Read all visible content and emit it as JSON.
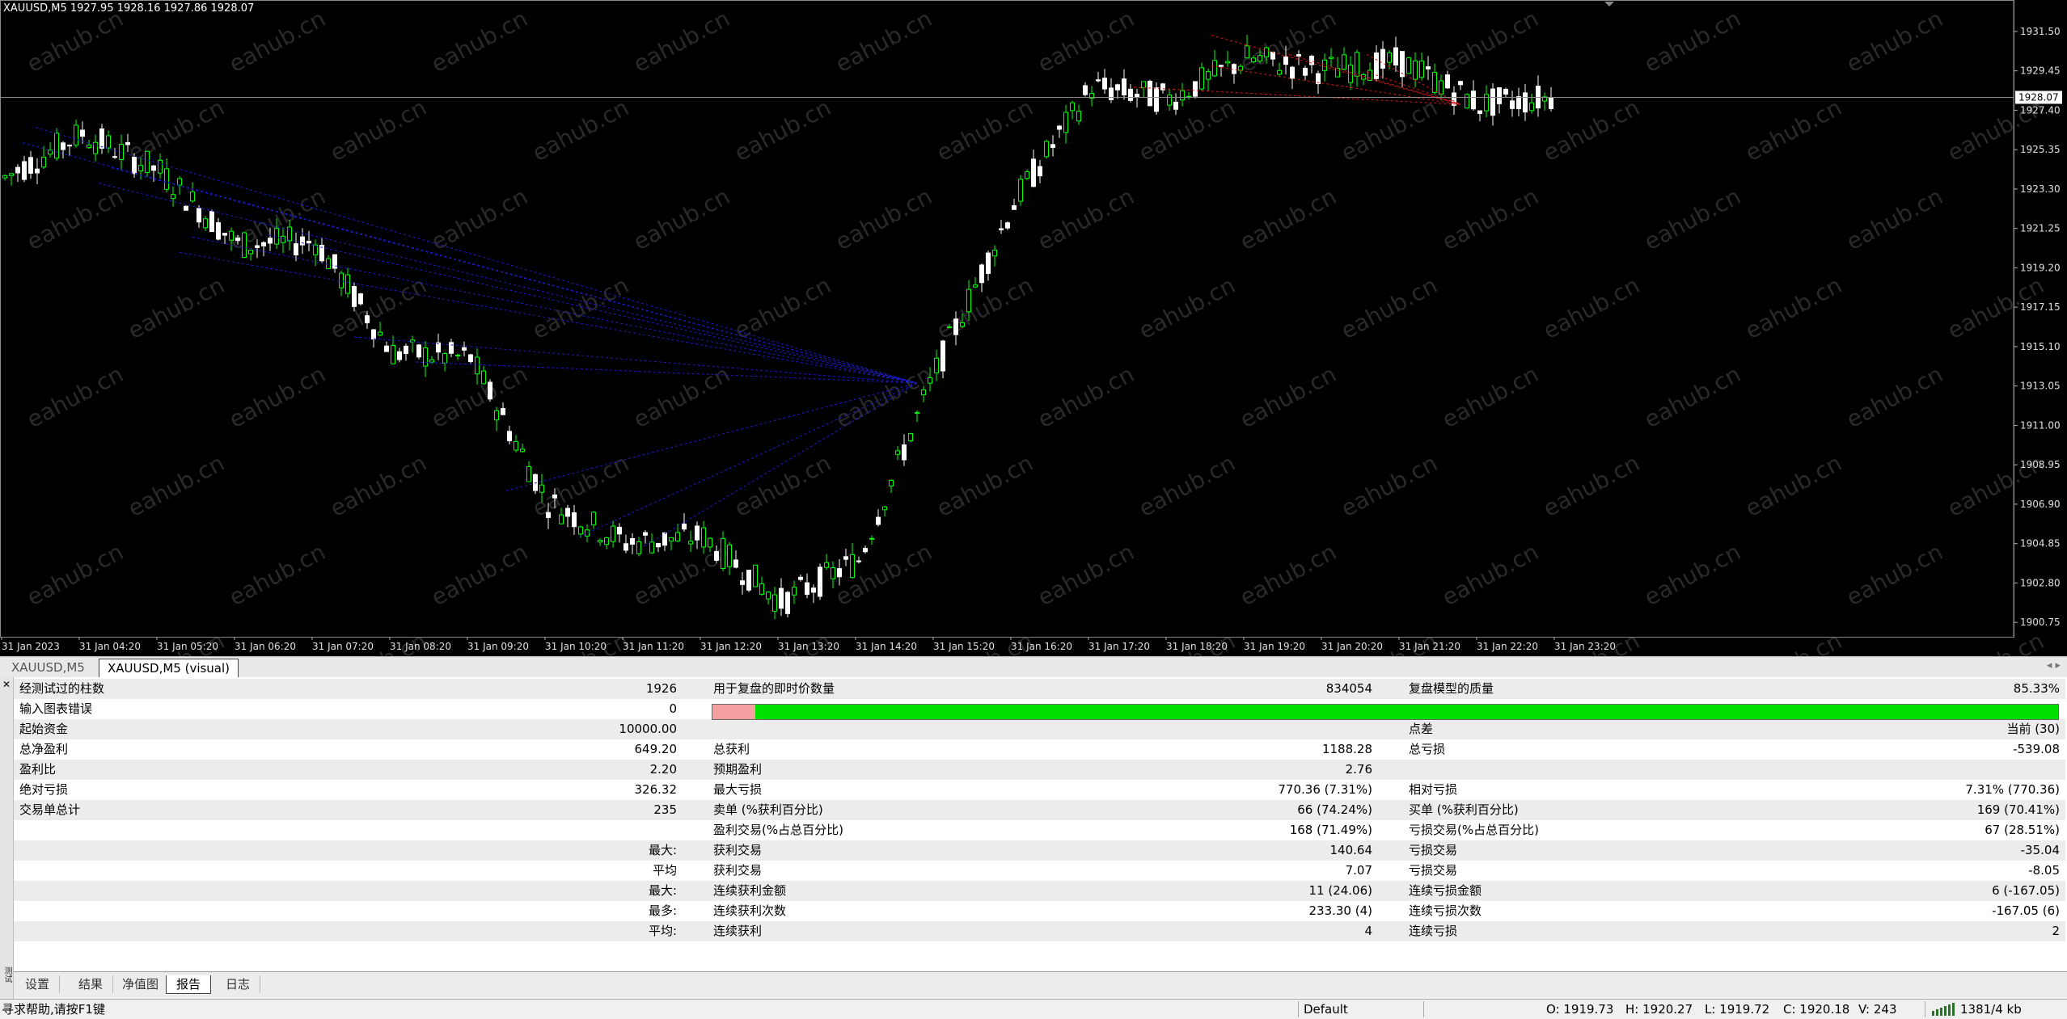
{
  "chart": {
    "title": "XAUUSD,M5  1927.95 1928.16 1927.86 1928.07",
    "current_price": "1928.07",
    "price_axis": [
      "1931.50",
      "1929.45",
      "1927.40",
      "1925.35",
      "1923.30",
      "1921.25",
      "1919.20",
      "1917.15",
      "1915.10",
      "1913.05",
      "1911.00",
      "1908.95",
      "1906.90",
      "1904.85",
      "1902.80",
      "1900.75"
    ],
    "time_axis": [
      "31 Jan 2023",
      "31 Jan 04:20",
      "31 Jan 05:20",
      "31 Jan 06:20",
      "31 Jan 07:20",
      "31 Jan 08:20",
      "31 Jan 09:20",
      "31 Jan 10:20",
      "31 Jan 11:20",
      "31 Jan 12:20",
      "31 Jan 13:20",
      "31 Jan 14:20",
      "31 Jan 15:20",
      "31 Jan 16:20",
      "31 Jan 17:20",
      "31 Jan 18:20",
      "31 Jan 19:20",
      "31 Jan 20:20",
      "31 Jan 21:20",
      "31 Jan 22:20",
      "31 Jan 23:20"
    ],
    "colors": {
      "background": "#000000",
      "bull": "#00ff00",
      "bear": "#ffffff",
      "buy_lines": "#1c1cc8",
      "sell_lines": "#d01818"
    }
  },
  "chart_data": {
    "type": "line",
    "x": [
      "31 Jan 03:20",
      "31 Jan 04:20",
      "31 Jan 05:20",
      "31 Jan 06:20",
      "31 Jan 07:20",
      "31 Jan 08:20",
      "31 Jan 09:20",
      "31 Jan 10:20",
      "31 Jan 11:20",
      "31 Jan 12:20",
      "31 Jan 13:20",
      "31 Jan 14:20",
      "31 Jan 15:20",
      "31 Jan 16:20",
      "31 Jan 17:20",
      "31 Jan 18:20",
      "31 Jan 19:20",
      "31 Jan 20:20",
      "31 Jan 21:20",
      "31 Jan 22:20",
      "31 Jan 23:20"
    ],
    "series": [
      {
        "values": [
          1923.9,
          1926.2,
          1924.2,
          1920.4,
          1920.6,
          1914.8,
          1914.5,
          1907.0,
          1904.9,
          1905.2,
          1901.8,
          1904.0,
          1913.9,
          1922.6,
          1928.6,
          1928.0,
          1930.1,
          1929.5,
          1929.9,
          1927.7,
          1928.1
        ]
      }
    ],
    "ylim": [
      1900.0,
      1932.8
    ],
    "grid": false
  },
  "chart_tabs": [
    "XAUUSD,M5",
    "XAUUSD,M5 (visual)"
  ],
  "report": {
    "rows": [
      {
        "l1": "经测试过的柱数",
        "v1": "1926",
        "l2": "用于复盘的即时价数量",
        "v2": "834054",
        "l3": "复盘模型的质量",
        "v3": "85.33%"
      },
      {
        "l1": "输入图表错误",
        "v1": "0",
        "l2": "",
        "v2": "",
        "l3": "",
        "v3": ""
      },
      {
        "l1": "起始资金",
        "v1": "10000.00",
        "l2": "",
        "v2": "",
        "l3": "点差",
        "v3": "当前 (30)"
      },
      {
        "l1": "总净盈利",
        "v1": "649.20",
        "l2": "总获利",
        "v2": "1188.28",
        "l3": "总亏损",
        "v3": "-539.08"
      },
      {
        "l1": "盈利比",
        "v1": "2.20",
        "l2": "预期盈利",
        "v2": "2.76",
        "l3": "",
        "v3": ""
      },
      {
        "l1": "绝对亏损",
        "v1": "326.32",
        "l2": "最大亏损",
        "v2": "770.36 (7.31%)",
        "l3": "相对亏损",
        "v3": "7.31% (770.36)"
      },
      {
        "l1": "交易单总计",
        "v1": "235",
        "l2": "卖单 (%获利百分比)",
        "v2": "66 (74.24%)",
        "l3": "买单 (%获利百分比)",
        "v3": "169 (70.41%)"
      },
      {
        "l1": "",
        "v1": "",
        "l2": "盈利交易(%占总百分比)",
        "v2": "168 (71.49%)",
        "l3": "亏损交易(%占总百分比)",
        "v3": "67 (28.51%)"
      },
      {
        "l1": "",
        "v1": "最大:",
        "l2": "获利交易",
        "v2": "140.64",
        "l3": "亏损交易",
        "v3": "-35.04"
      },
      {
        "l1": "",
        "v1": "平均",
        "l2": "获利交易",
        "v2": "7.07",
        "l3": "亏损交易",
        "v3": "-8.05"
      },
      {
        "l1": "",
        "v1": "最大:",
        "l2": "连续获利金额",
        "v2": "11 (24.06)",
        "l3": "连续亏损金额",
        "v3": "6 (-167.05)"
      },
      {
        "l1": "",
        "v1": "最多:",
        "l2": "连续获利次数",
        "v2": "233.30 (4)",
        "l3": "连续亏损次数",
        "v3": "-167.05 (6)"
      },
      {
        "l1": "",
        "v1": "平均:",
        "l2": "连续获利",
        "v2": "4",
        "l3": "连续亏损",
        "v3": "2"
      }
    ],
    "quality_error_pct": 3.2
  },
  "tester_tabs": [
    "设置",
    "结果",
    "净值图",
    "报告",
    "日志"
  ],
  "tester_active_tab": 3,
  "strip_label": "测试",
  "status": {
    "help": "寻求帮助,请按F1键",
    "profile": "Default",
    "open": "O: 1919.73",
    "high": "H: 1920.27",
    "low": "L: 1919.72",
    "close": "C: 1920.18",
    "volume": "V: 243",
    "traffic": "1381/4 kb"
  },
  "watermark": "eahub.cn"
}
